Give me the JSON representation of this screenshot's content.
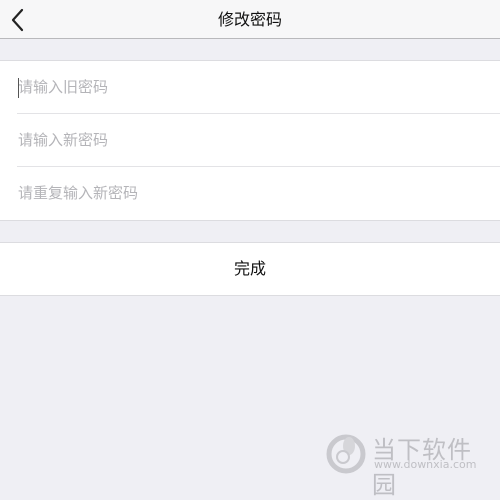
{
  "navbar": {
    "title": "修改密码",
    "back_icon": "chevron-left-icon"
  },
  "form": {
    "fields": [
      {
        "placeholder": "请输入旧密码",
        "value": ""
      },
      {
        "placeholder": "请输入新密码",
        "value": ""
      },
      {
        "placeholder": "请重复输入新密码",
        "value": ""
      }
    ]
  },
  "submit": {
    "label": "完成"
  },
  "watermark": {
    "brand": "当下软件园",
    "url": "www.downxia.com",
    "logo_icon": "downxia-logo-icon"
  },
  "colors": {
    "background": "#efeff4",
    "navbar": "#f7f7f8",
    "card": "#ffffff",
    "placeholder": "#b4b4b8",
    "text": "#111111"
  }
}
